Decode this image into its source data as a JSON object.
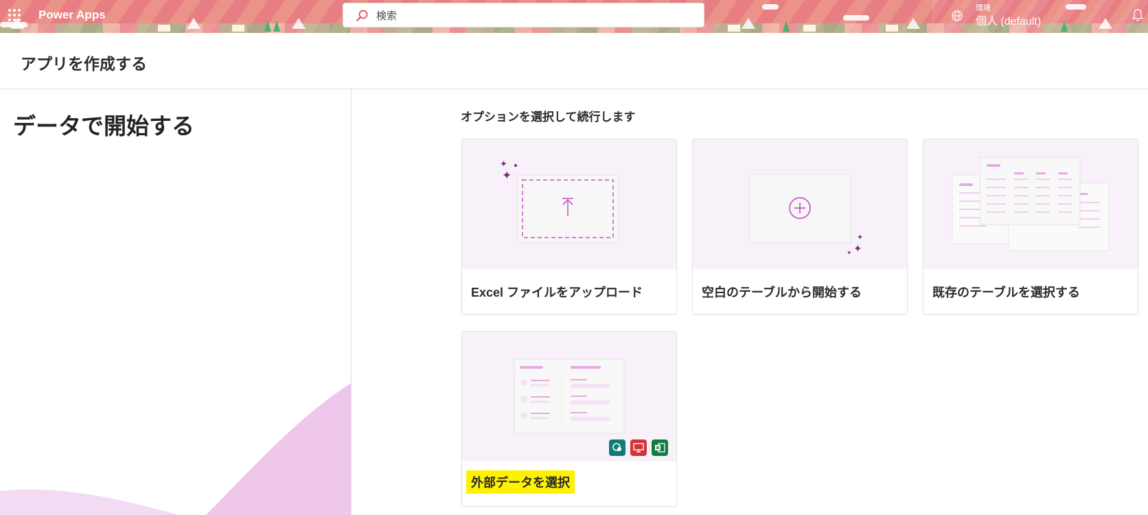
{
  "header": {
    "app_name": "Power Apps",
    "search_placeholder": "検索",
    "environment_label": "環境",
    "environment_value": "個人 (default)"
  },
  "page": {
    "title": "アプリを作成する"
  },
  "left_pane": {
    "heading": "データで開始する"
  },
  "options": {
    "subtitle": "オプションを選択して続行します",
    "cards": [
      {
        "label": "Excel ファイルをアップロード",
        "icon": "upload-icon"
      },
      {
        "label": "空白のテーブルから開始する",
        "icon": "add-circle-icon"
      },
      {
        "label": "既存のテーブルを選択する",
        "icon": "tables-icon"
      },
      {
        "label": "外部データを選択",
        "icon": "external-data-icon",
        "highlighted": true
      }
    ]
  },
  "colors": {
    "accent": "#c75bc9",
    "card_bg": "#f8f1fa",
    "highlight": "#fff200",
    "header_band": "#e77e84"
  }
}
